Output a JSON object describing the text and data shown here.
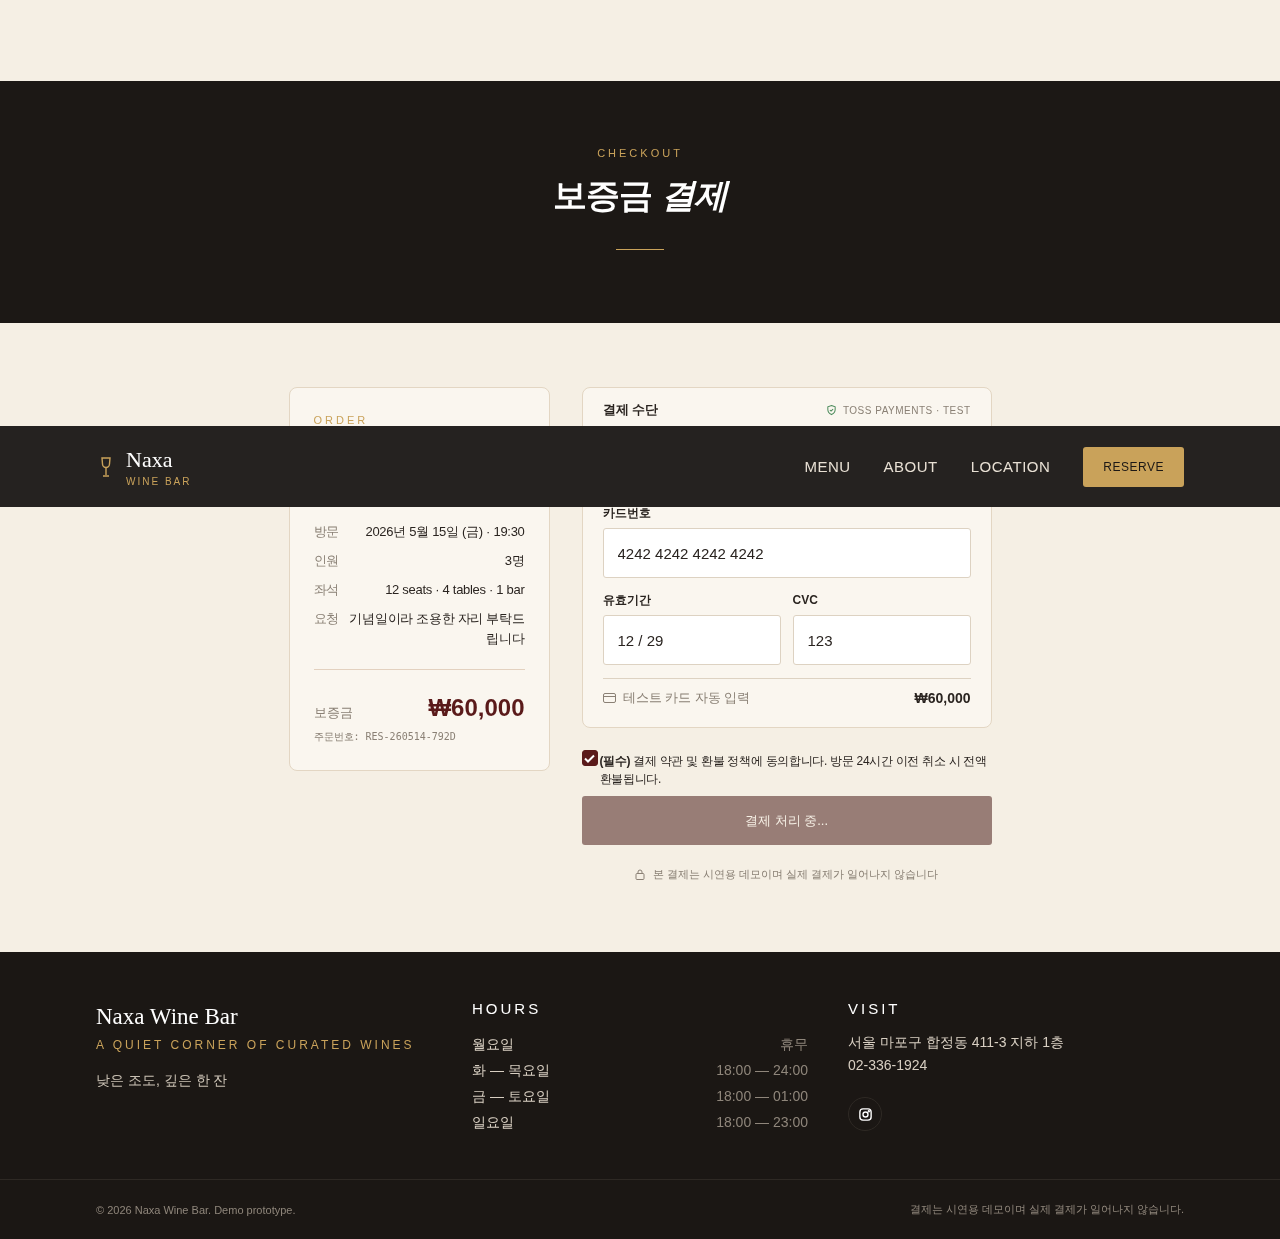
{
  "nav": {
    "brand": "Naxa",
    "tagline": "WINE BAR",
    "links": [
      {
        "label": "MENU"
      },
      {
        "label": "ABOUT"
      },
      {
        "label": "LOCATION"
      }
    ],
    "cta": "RESERVE"
  },
  "hero": {
    "eyebrow": "CHECKOUT",
    "title": "보증금 *결제*"
  },
  "order": {
    "label": "ORDER",
    "rows": [
      {
        "label": "방문",
        "value": "2026년 5월 15일 (금) · 19:30"
      },
      {
        "label": "인원",
        "value": "3명"
      },
      {
        "label": "좌석",
        "value": "12 seats · 4 tables · 1 bar"
      },
      {
        "label": "요청",
        "value": "기념일이라 조용한 자리 부탁드립니다"
      }
    ],
    "deposit_label": "보증금",
    "deposit_amount": "₩60,000",
    "order_number": "주문번호: RES-260514-792D"
  },
  "payment": {
    "title": "결제 수단",
    "badge": "TOSS PAYMENTS · TEST",
    "fields": [
      {
        "label": "카드번호",
        "value": "4242 4242 4242 4242"
      },
      {
        "label": "유효기간",
        "value": "12 / 29"
      },
      {
        "label": "CVC",
        "value": "123"
      }
    ],
    "autofill": "테스트 카드 자동 입력",
    "total": "₩60,000"
  },
  "agreement": {
    "checked": true,
    "text": "**(필수)** 결제 약관 및 환불 정책에 동의합니다. 방문 24시간 이전 취소 시 전액 환불됩니다."
  },
  "submit": {
    "label": "결제 처리 중...",
    "disabled": true
  },
  "notice": "본 결제는 시연용 데모이며 실제 결제가 일어나지 않습니다",
  "footer": {
    "name": "Naxa Wine Bar",
    "tagline": "A QUIET CORNER OF CURATED WINES",
    "motto": "낮은 조도, 깊은 한 잔",
    "hours_title": "HOURS",
    "hours": [
      {
        "day": "월요일",
        "time": "휴무"
      },
      {
        "day": "화 — 목요일",
        "time": "18:00 — 24:00"
      },
      {
        "day": "금 — 토요일",
        "time": "18:00 — 01:00"
      },
      {
        "day": "일요일",
        "time": "18:00 — 23:00"
      }
    ],
    "visit_title": "VISIT",
    "address": "서울 마포구 합정동 411-3 지하 1층",
    "phone": "02-336-1924",
    "copyright": "© 2026 Naxa Wine Bar. Demo prototype.",
    "disclaimer": "결제는 시연용 데모이며 실제 결제가 일어나지 않습니다."
  }
}
